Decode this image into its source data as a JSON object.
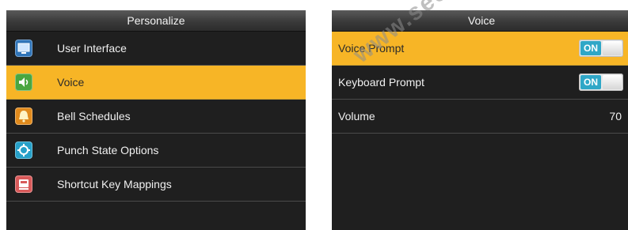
{
  "personalize": {
    "title": "Personalize",
    "items": [
      {
        "label": "User Interface",
        "icon": "user-interface-icon",
        "selected": false
      },
      {
        "label": "Voice",
        "icon": "voice-icon",
        "selected": true
      },
      {
        "label": "Bell Schedules",
        "icon": "bell-schedules-icon",
        "selected": false
      },
      {
        "label": "Punch State Options",
        "icon": "punch-state-icon",
        "selected": false
      },
      {
        "label": "Shortcut Key Mappings",
        "icon": "shortcut-key-icon",
        "selected": false
      }
    ]
  },
  "voice": {
    "title": "Voice",
    "items": [
      {
        "label": "Voice Prompt",
        "toggle": "ON",
        "selected": true
      },
      {
        "label": "Keyboard Prompt",
        "toggle": "ON",
        "selected": false
      },
      {
        "label": "Volume",
        "value": "70",
        "selected": false
      }
    ]
  },
  "watermark": "www.sec",
  "colors": {
    "highlight": "#f7b526",
    "background": "#1f1f1f",
    "toggle_on": "#2fa7c7"
  }
}
